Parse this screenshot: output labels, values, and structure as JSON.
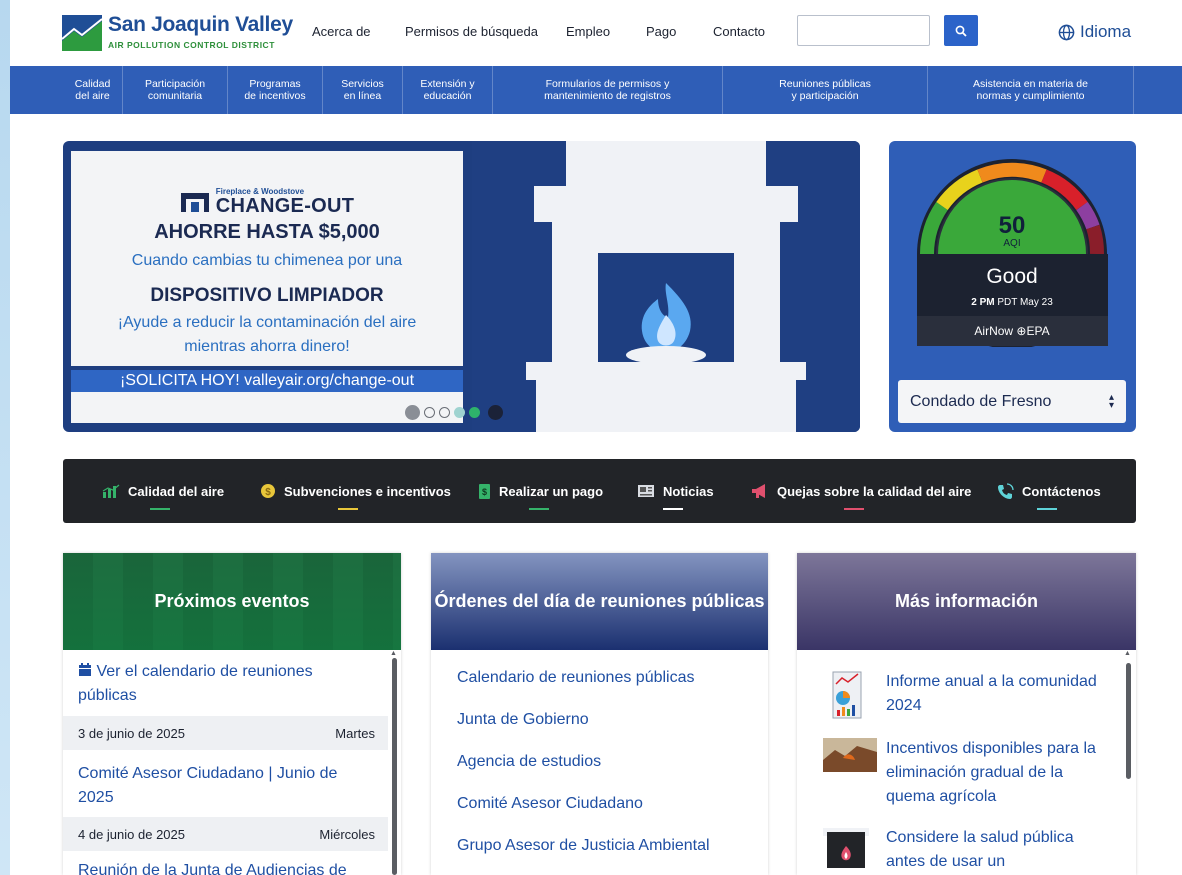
{
  "logo": {
    "title": "San Joaquin Valley",
    "subtitle": "AIR POLLUTION CONTROL DISTRICT",
    "icon": "district-logo"
  },
  "topnav": [
    "Acerca de",
    "Permisos de búsqueda",
    "Empleo",
    "Pago",
    "Contacto"
  ],
  "search": {
    "placeholder": "",
    "icon": "search-icon"
  },
  "language": {
    "label": "Idioma",
    "icon": "globe-icon"
  },
  "mainnav": [
    {
      "line1": "Calidad",
      "line2": "del aire"
    },
    {
      "line1": "Participación",
      "line2": "comunitaria"
    },
    {
      "line1": "Programas",
      "line2": "de incentivos"
    },
    {
      "line1": "Servicios",
      "line2": "en línea"
    },
    {
      "line1": "Extensión y",
      "line2": "educación"
    },
    {
      "line1": "Formularios de permisos y",
      "line2": "mantenimiento de registros"
    },
    {
      "line1": "Reuniones públicas",
      "line2": "y participación"
    },
    {
      "line1": "Asistencia en materia de",
      "line2": "normas y cumplimiento"
    }
  ],
  "carousel": {
    "brand_small": "Fireplace & Woodstove",
    "brand_big": "CHANGE-OUT",
    "headline": "AHORRE HASTA $5,000",
    "line1": "Cuando cambias tu chimenea por una",
    "line2": "DISPOSITIVO LIMPIADOR",
    "line3": "¡Ayude a reducir la contaminación del aire",
    "line4": "mientras ahorra dinero!",
    "cta": "¡SOLICITA HOY! valleyair.org/change-out",
    "slides_total": 5,
    "active_slide": 4
  },
  "aqi": {
    "value": "50",
    "unit": "AQI",
    "status": "Good",
    "time_bold": "2 PM",
    "time_rest": "PDT May 23",
    "source": "AirNow ⊕EPA",
    "county": "Condado de Fresno",
    "colors": {
      "good": "#3aa83a",
      "moderate": "#e8d21c",
      "usg": "#f08a1c",
      "unhealthy": "#d8202a",
      "very": "#8d3fa0",
      "hazardous": "#8a1e2a"
    }
  },
  "quicklinks": [
    {
      "label": "Calidad del aire",
      "icon": "chart-icon",
      "color": "#35b36a"
    },
    {
      "label": "Subvenciones e incentivos",
      "icon": "coin-icon",
      "color": "#e8c63a"
    },
    {
      "label": "Realizar un pago",
      "icon": "payment-icon",
      "color": "#35b36a"
    },
    {
      "label": "Noticias",
      "icon": "news-icon",
      "color": "#ffffff"
    },
    {
      "label": "Quejas sobre la calidad del aire",
      "icon": "megaphone-icon",
      "color": "#e0506e"
    },
    {
      "label": "Contáctenos",
      "icon": "phone-icon",
      "color": "#5fd3d8"
    }
  ],
  "events": {
    "title": "Próximos eventos",
    "calendar_link": "Ver el calendario de reuniones públicas",
    "items": [
      {
        "date": "3 de junio de 2025",
        "day": "Martes",
        "title": "Comité Asesor Ciudadano | Junio de 2025"
      },
      {
        "date": "4 de junio de 2025",
        "day": "Miércoles",
        "title": "Reunión de la Junta de Audiencias de"
      }
    ]
  },
  "agendas": {
    "title": "Órdenes del día de reuniones públicas",
    "links": [
      "Calendario de reuniones públicas",
      "Junta de Gobierno",
      "Agencia de estudios",
      "Comité Asesor Ciudadano",
      "Grupo Asesor de Justicia Ambiental"
    ]
  },
  "more": {
    "title": "Más información",
    "items": [
      {
        "text": "Informe anual a la comunidad 2024",
        "icon": "report-icon"
      },
      {
        "text": "Incentivos disponibles para la eliminación gradual de la quema agrícola",
        "icon": "burning-icon"
      },
      {
        "text": "Considere la salud pública antes de usar un",
        "icon": "fireplace-icon"
      }
    ]
  }
}
